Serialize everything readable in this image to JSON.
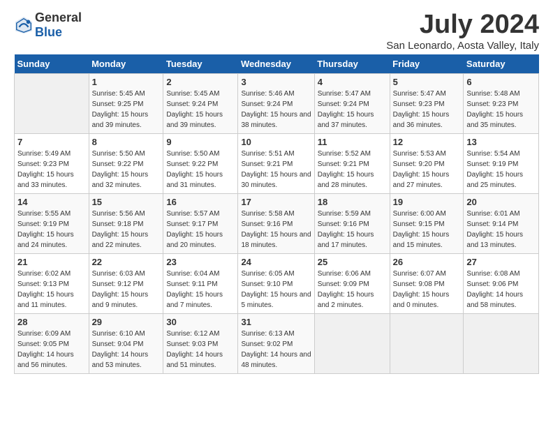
{
  "header": {
    "logo_general": "General",
    "logo_blue": "Blue",
    "month_title": "July 2024",
    "location": "San Leonardo, Aosta Valley, Italy"
  },
  "days_of_week": [
    "Sunday",
    "Monday",
    "Tuesday",
    "Wednesday",
    "Thursday",
    "Friday",
    "Saturday"
  ],
  "weeks": [
    [
      {
        "num": "",
        "sunrise": "",
        "sunset": "",
        "daylight": "",
        "empty": true
      },
      {
        "num": "1",
        "sunrise": "Sunrise: 5:45 AM",
        "sunset": "Sunset: 9:25 PM",
        "daylight": "Daylight: 15 hours and 39 minutes."
      },
      {
        "num": "2",
        "sunrise": "Sunrise: 5:45 AM",
        "sunset": "Sunset: 9:24 PM",
        "daylight": "Daylight: 15 hours and 39 minutes."
      },
      {
        "num": "3",
        "sunrise": "Sunrise: 5:46 AM",
        "sunset": "Sunset: 9:24 PM",
        "daylight": "Daylight: 15 hours and 38 minutes."
      },
      {
        "num": "4",
        "sunrise": "Sunrise: 5:47 AM",
        "sunset": "Sunset: 9:24 PM",
        "daylight": "Daylight: 15 hours and 37 minutes."
      },
      {
        "num": "5",
        "sunrise": "Sunrise: 5:47 AM",
        "sunset": "Sunset: 9:23 PM",
        "daylight": "Daylight: 15 hours and 36 minutes."
      },
      {
        "num": "6",
        "sunrise": "Sunrise: 5:48 AM",
        "sunset": "Sunset: 9:23 PM",
        "daylight": "Daylight: 15 hours and 35 minutes."
      }
    ],
    [
      {
        "num": "7",
        "sunrise": "Sunrise: 5:49 AM",
        "sunset": "Sunset: 9:23 PM",
        "daylight": "Daylight: 15 hours and 33 minutes."
      },
      {
        "num": "8",
        "sunrise": "Sunrise: 5:50 AM",
        "sunset": "Sunset: 9:22 PM",
        "daylight": "Daylight: 15 hours and 32 minutes."
      },
      {
        "num": "9",
        "sunrise": "Sunrise: 5:50 AM",
        "sunset": "Sunset: 9:22 PM",
        "daylight": "Daylight: 15 hours and 31 minutes."
      },
      {
        "num": "10",
        "sunrise": "Sunrise: 5:51 AM",
        "sunset": "Sunset: 9:21 PM",
        "daylight": "Daylight: 15 hours and 30 minutes."
      },
      {
        "num": "11",
        "sunrise": "Sunrise: 5:52 AM",
        "sunset": "Sunset: 9:21 PM",
        "daylight": "Daylight: 15 hours and 28 minutes."
      },
      {
        "num": "12",
        "sunrise": "Sunrise: 5:53 AM",
        "sunset": "Sunset: 9:20 PM",
        "daylight": "Daylight: 15 hours and 27 minutes."
      },
      {
        "num": "13",
        "sunrise": "Sunrise: 5:54 AM",
        "sunset": "Sunset: 9:19 PM",
        "daylight": "Daylight: 15 hours and 25 minutes."
      }
    ],
    [
      {
        "num": "14",
        "sunrise": "Sunrise: 5:55 AM",
        "sunset": "Sunset: 9:19 PM",
        "daylight": "Daylight: 15 hours and 24 minutes."
      },
      {
        "num": "15",
        "sunrise": "Sunrise: 5:56 AM",
        "sunset": "Sunset: 9:18 PM",
        "daylight": "Daylight: 15 hours and 22 minutes."
      },
      {
        "num": "16",
        "sunrise": "Sunrise: 5:57 AM",
        "sunset": "Sunset: 9:17 PM",
        "daylight": "Daylight: 15 hours and 20 minutes."
      },
      {
        "num": "17",
        "sunrise": "Sunrise: 5:58 AM",
        "sunset": "Sunset: 9:16 PM",
        "daylight": "Daylight: 15 hours and 18 minutes."
      },
      {
        "num": "18",
        "sunrise": "Sunrise: 5:59 AM",
        "sunset": "Sunset: 9:16 PM",
        "daylight": "Daylight: 15 hours and 17 minutes."
      },
      {
        "num": "19",
        "sunrise": "Sunrise: 6:00 AM",
        "sunset": "Sunset: 9:15 PM",
        "daylight": "Daylight: 15 hours and 15 minutes."
      },
      {
        "num": "20",
        "sunrise": "Sunrise: 6:01 AM",
        "sunset": "Sunset: 9:14 PM",
        "daylight": "Daylight: 15 hours and 13 minutes."
      }
    ],
    [
      {
        "num": "21",
        "sunrise": "Sunrise: 6:02 AM",
        "sunset": "Sunset: 9:13 PM",
        "daylight": "Daylight: 15 hours and 11 minutes."
      },
      {
        "num": "22",
        "sunrise": "Sunrise: 6:03 AM",
        "sunset": "Sunset: 9:12 PM",
        "daylight": "Daylight: 15 hours and 9 minutes."
      },
      {
        "num": "23",
        "sunrise": "Sunrise: 6:04 AM",
        "sunset": "Sunset: 9:11 PM",
        "daylight": "Daylight: 15 hours and 7 minutes."
      },
      {
        "num": "24",
        "sunrise": "Sunrise: 6:05 AM",
        "sunset": "Sunset: 9:10 PM",
        "daylight": "Daylight: 15 hours and 5 minutes."
      },
      {
        "num": "25",
        "sunrise": "Sunrise: 6:06 AM",
        "sunset": "Sunset: 9:09 PM",
        "daylight": "Daylight: 15 hours and 2 minutes."
      },
      {
        "num": "26",
        "sunrise": "Sunrise: 6:07 AM",
        "sunset": "Sunset: 9:08 PM",
        "daylight": "Daylight: 15 hours and 0 minutes."
      },
      {
        "num": "27",
        "sunrise": "Sunrise: 6:08 AM",
        "sunset": "Sunset: 9:06 PM",
        "daylight": "Daylight: 14 hours and 58 minutes."
      }
    ],
    [
      {
        "num": "28",
        "sunrise": "Sunrise: 6:09 AM",
        "sunset": "Sunset: 9:05 PM",
        "daylight": "Daylight: 14 hours and 56 minutes."
      },
      {
        "num": "29",
        "sunrise": "Sunrise: 6:10 AM",
        "sunset": "Sunset: 9:04 PM",
        "daylight": "Daylight: 14 hours and 53 minutes."
      },
      {
        "num": "30",
        "sunrise": "Sunrise: 6:12 AM",
        "sunset": "Sunset: 9:03 PM",
        "daylight": "Daylight: 14 hours and 51 minutes."
      },
      {
        "num": "31",
        "sunrise": "Sunrise: 6:13 AM",
        "sunset": "Sunset: 9:02 PM",
        "daylight": "Daylight: 14 hours and 48 minutes."
      },
      {
        "num": "",
        "sunrise": "",
        "sunset": "",
        "daylight": "",
        "empty": true
      },
      {
        "num": "",
        "sunrise": "",
        "sunset": "",
        "daylight": "",
        "empty": true
      },
      {
        "num": "",
        "sunrise": "",
        "sunset": "",
        "daylight": "",
        "empty": true
      }
    ]
  ]
}
